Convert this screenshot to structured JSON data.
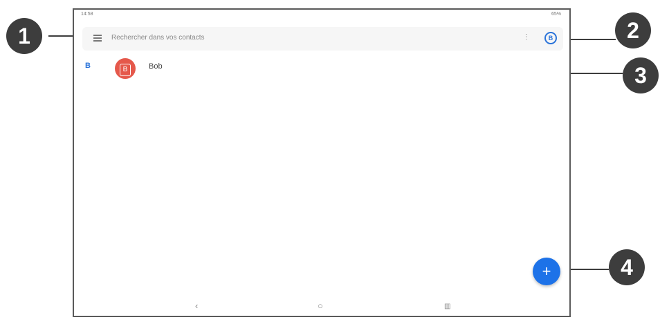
{
  "status": {
    "time": "14:58",
    "battery": "65%"
  },
  "search": {
    "placeholder": "Rechercher dans vos contacts",
    "more_label": "⋮",
    "account_label": "B"
  },
  "contacts": [
    {
      "section_letter": "B",
      "avatar_letter": "B",
      "name": "Bob"
    }
  ],
  "fab": {
    "label": "+"
  },
  "nav": {
    "back": "‹",
    "home": "○",
    "recents": "▥"
  },
  "callouts": [
    "1",
    "2",
    "3",
    "4"
  ],
  "colors": {
    "accent": "#1d72e8",
    "avatar": "#e5584b",
    "callout": "#3d3d3d"
  }
}
